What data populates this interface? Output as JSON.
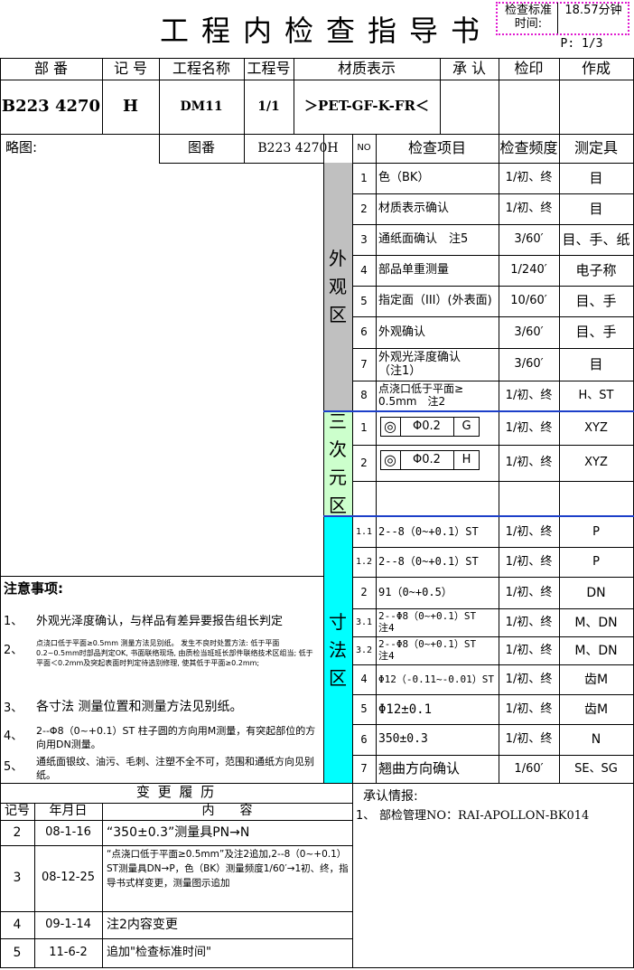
{
  "title": "工程内检查指导书",
  "std_time": {
    "label": "检查标准时间:",
    "value": "18.57分钟"
  },
  "page": "P: 1/3",
  "header": {
    "labels": [
      "部 番",
      "记 号",
      "工程名称",
      "工程号",
      "材质表示",
      "承 认",
      "检印",
      "作成"
    ],
    "values": {
      "part_no": "B223 4270",
      "mark": "H",
      "process": "DM11",
      "process_no": "1/1",
      "material": "＞PET-GF-K-FR＜"
    }
  },
  "sketch": {
    "label": "略图:",
    "drawing_label": "图番",
    "drawing_no": "B223 4270H"
  },
  "table_head": {
    "no": "NO",
    "item": "检查项目",
    "freq": "检查频度",
    "tool": "测定具"
  },
  "zones": {
    "appearance": [
      "外",
      "观",
      "区"
    ],
    "cmm": [
      "三",
      "次",
      "元",
      "区"
    ],
    "dimension": [
      "寸",
      "法",
      "区"
    ]
  },
  "appearance_rows": [
    {
      "no": "1",
      "item": "色（BK）",
      "freq": "1/初、终",
      "tool": "目"
    },
    {
      "no": "2",
      "item": "材质表示确认",
      "freq": "1/初、终",
      "tool": "目"
    },
    {
      "no": "3",
      "item": "通纸面确认　注5",
      "freq": "3/60′",
      "tool": "目、手、纸"
    },
    {
      "no": "4",
      "item": "部品单重测量",
      "freq": "1/240′",
      "tool": "电子称"
    },
    {
      "no": "5",
      "item": "指定面（III）(外表面)",
      "freq": "10/60′",
      "tool": "目、手"
    },
    {
      "no": "6",
      "item": "外观确认",
      "freq": "3/60′",
      "tool": "目、手"
    },
    {
      "no": "7",
      "item": "外观光泽度确认（注1）",
      "freq": "3/60′",
      "tool": "目"
    },
    {
      "no": "8",
      "item": "点浇口低于平面≥ 0.5mm　注2",
      "freq": "1/初、终",
      "tool": "H、ST"
    }
  ],
  "cmm_rows": [
    {
      "no": "1",
      "symbol": "◎",
      "tol": "Φ0.2",
      "datum": "G",
      "freq": "1/初、终",
      "tool": "XYZ"
    },
    {
      "no": "2",
      "symbol": "◎",
      "tol": "Φ0.2",
      "datum": "H",
      "freq": "1/初、终",
      "tool": "XYZ"
    }
  ],
  "dimension_rows": [
    {
      "no": "1.1",
      "item": "2--8（0~+0.1）ST",
      "freq": "1/初、终",
      "tool": "P"
    },
    {
      "no": "1.2",
      "item": "2--8（0~+0.1）ST",
      "freq": "1/初、终",
      "tool": "P"
    },
    {
      "no": "2",
      "item": "91（0~+0.5）",
      "freq": "1/初、终",
      "tool": "DN"
    },
    {
      "no": "3.1",
      "item": "2--Φ8（0~+0.1）ST 注4",
      "freq": "1/初、终",
      "tool": "M、DN"
    },
    {
      "no": "3.2",
      "item": "2--Φ8（0~+0.1）ST 注4",
      "freq": "1/初、终",
      "tool": "M、DN"
    },
    {
      "no": "4",
      "item": "Φ12（-0.11~-0.01）ST",
      "freq": "1/初、终",
      "tool": "齿M"
    },
    {
      "no": "5",
      "item": "Φ12±0.1",
      "freq": "1/初、终",
      "tool": "齿M"
    },
    {
      "no": "6",
      "item": "350±0.3",
      "freq": "1/初、终",
      "tool": "N"
    },
    {
      "no": "7",
      "item": "翘曲方向确认",
      "freq": "1/60′",
      "tool": "SE、SG"
    }
  ],
  "notes": {
    "title": "注意事项:",
    "items": [
      {
        "no": "1、",
        "text": "外观光泽度确认，与样品有差异要报告组长判定"
      },
      {
        "no": "2、",
        "text": "点浇口低于平面≥0.5mm 测量方法见别纸。 发生不良时处置方法: 低于平面0.2~0.5mm时部品判定OK, 书面联络现场, 由质检当班班长部件联络技术区组当; 低于平面＜0.2mm及突起表面时判定待选别修理, 使其低于平面≥0.2mm;"
      },
      {
        "no": "3、",
        "text": "各寸法 测量位置和测量方法见别纸。"
      },
      {
        "no": "4、",
        "text": "2--Φ8（0~+0.1）ST 柱子圆的方向用M测量，有突起部位的方向用DN测量。"
      },
      {
        "no": "5、",
        "text": "通纸面银纹、油污、毛刺、注塑不全不可，范围和通纸方向见别纸。"
      }
    ]
  },
  "history": {
    "title": "变 更 履 历",
    "headers": [
      "记号",
      "年月日",
      "内　　容"
    ],
    "rows": [
      {
        "mark": "2",
        "date": "08-1-16",
        "content": "“350±0.3”测量具PN→N"
      },
      {
        "mark": "3",
        "date": "08-12-25",
        "content": "“点浇口低于平面≥0.5mm”及注2追加,2--8（0~+0.1）ST测量具DN→P，色（BK）测量频度1/60′→1初、终，指导书式样变更，测量图示追加"
      },
      {
        "mark": "4",
        "date": "09-1-14",
        "content": "注2内容变更"
      },
      {
        "mark": "5",
        "date": "11-6-2",
        "content": "追加\"检查标准时间\""
      }
    ]
  },
  "approval": {
    "title": "承认情报:",
    "items": [
      {
        "no": "1、",
        "text": "部检管理NO：RAI-APOLLON-BK014"
      }
    ]
  }
}
